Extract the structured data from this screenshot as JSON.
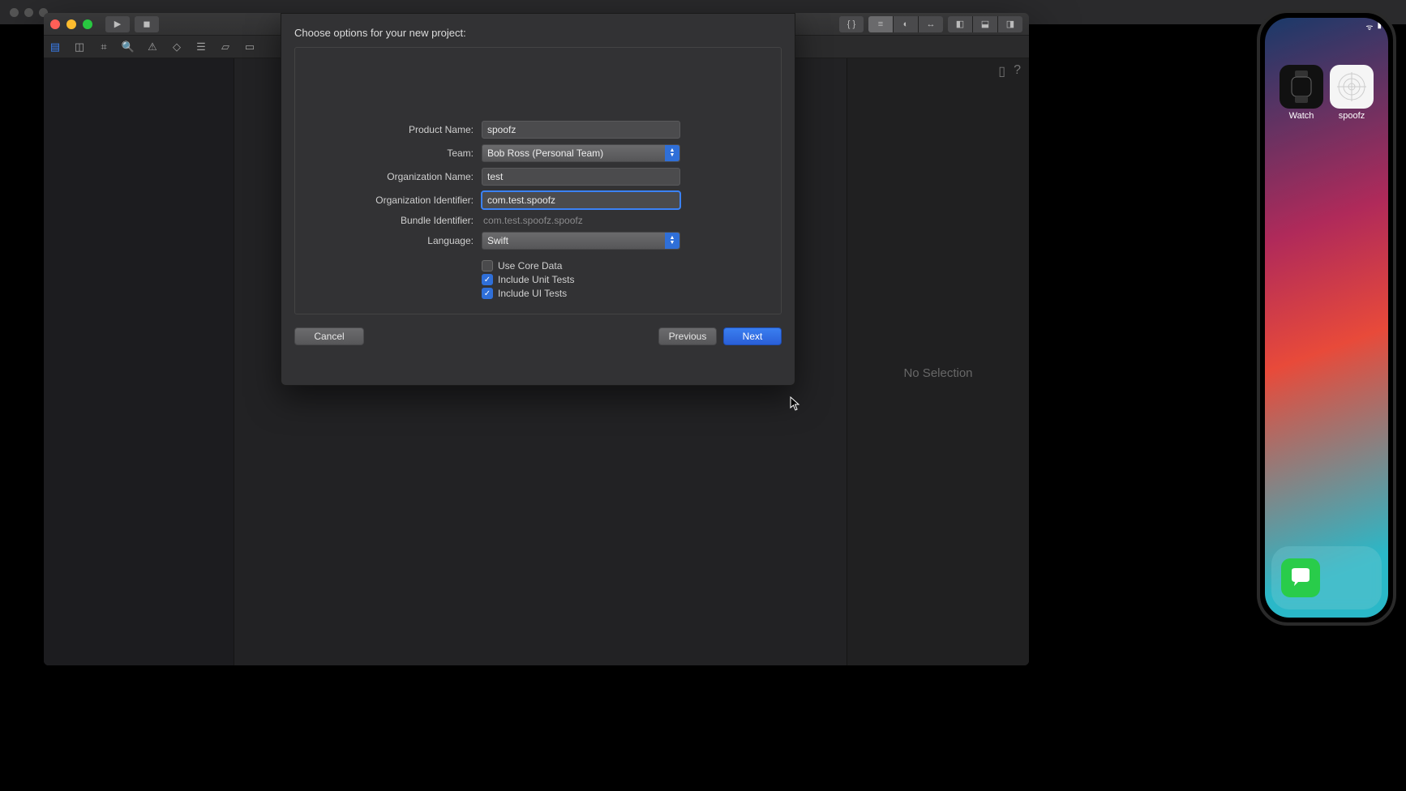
{
  "sheet": {
    "title": "Choose options for your new project:",
    "labels": {
      "productName": "Product Name:",
      "team": "Team:",
      "orgName": "Organization Name:",
      "orgId": "Organization Identifier:",
      "bundleId": "Bundle Identifier:",
      "language": "Language:"
    },
    "values": {
      "productName": "spoofz",
      "team": "Bob Ross (Personal Team)",
      "orgName": "test",
      "orgId": "com.test.spoofz",
      "bundleId": "com.test.spoofz.spoofz",
      "language": "Swift"
    },
    "checks": {
      "coreData": "Use Core Data",
      "unitTests": "Include Unit Tests",
      "uiTests": "Include UI Tests"
    },
    "buttons": {
      "cancel": "Cancel",
      "previous": "Previous",
      "next": "Next"
    }
  },
  "rightPanel": {
    "noSelection": "No Selection"
  },
  "device": {
    "apps": {
      "watch": "Watch",
      "spoofz": "spoofz"
    }
  }
}
